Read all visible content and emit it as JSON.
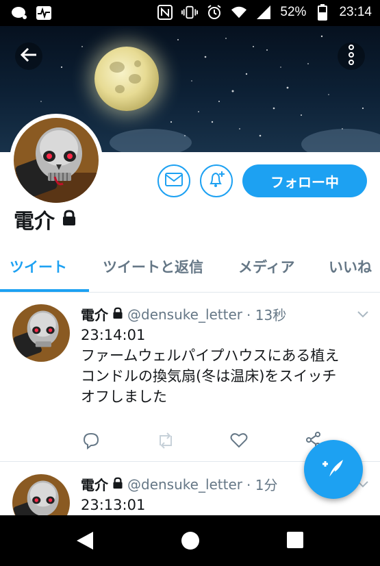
{
  "status_bar": {
    "battery": "52%",
    "time": "23:14",
    "icons": [
      "chat-bubble-icon",
      "activity-icon",
      "nfc-icon",
      "vibrate-icon",
      "alarm-icon",
      "wifi-icon",
      "signal-icon",
      "battery-icon"
    ]
  },
  "header": {
    "back_icon": "arrow-left-icon",
    "more_icon": "more-vert-icon"
  },
  "profile": {
    "name": "電介",
    "lock_icon": "lock-icon",
    "message_icon": "mail-icon",
    "notify_icon": "bell-plus-icon",
    "follow_label": "フォロー中"
  },
  "tabs": [
    {
      "label": "ツイート",
      "active": true
    },
    {
      "label": "ツイートと返信",
      "active": false
    },
    {
      "label": "メディア",
      "active": false
    },
    {
      "label": "いいね",
      "active": false
    }
  ],
  "tweets": [
    {
      "name": "電介",
      "handle": "@densuke_letter",
      "time": "· 13秒",
      "lines": [
        "23:14:01",
        "ファームウェルパイプハウスにある植え",
        "コンドルの換気扇(冬は温床)をスイッチ",
        "オフしました"
      ]
    },
    {
      "name": "電介",
      "handle": "@densuke_letter",
      "time": "· 1分",
      "lines": [
        "23:13:01"
      ]
    }
  ],
  "actions": [
    "reply-icon",
    "retweet-icon",
    "like-icon",
    "share-icon"
  ],
  "fab_icon": "compose-tweet-icon",
  "nav": [
    "back-triangle-icon",
    "home-circle-icon",
    "recents-square-icon"
  ],
  "colors": {
    "accent": "#1da1f2",
    "text": "#14171a",
    "muted": "#657786"
  }
}
